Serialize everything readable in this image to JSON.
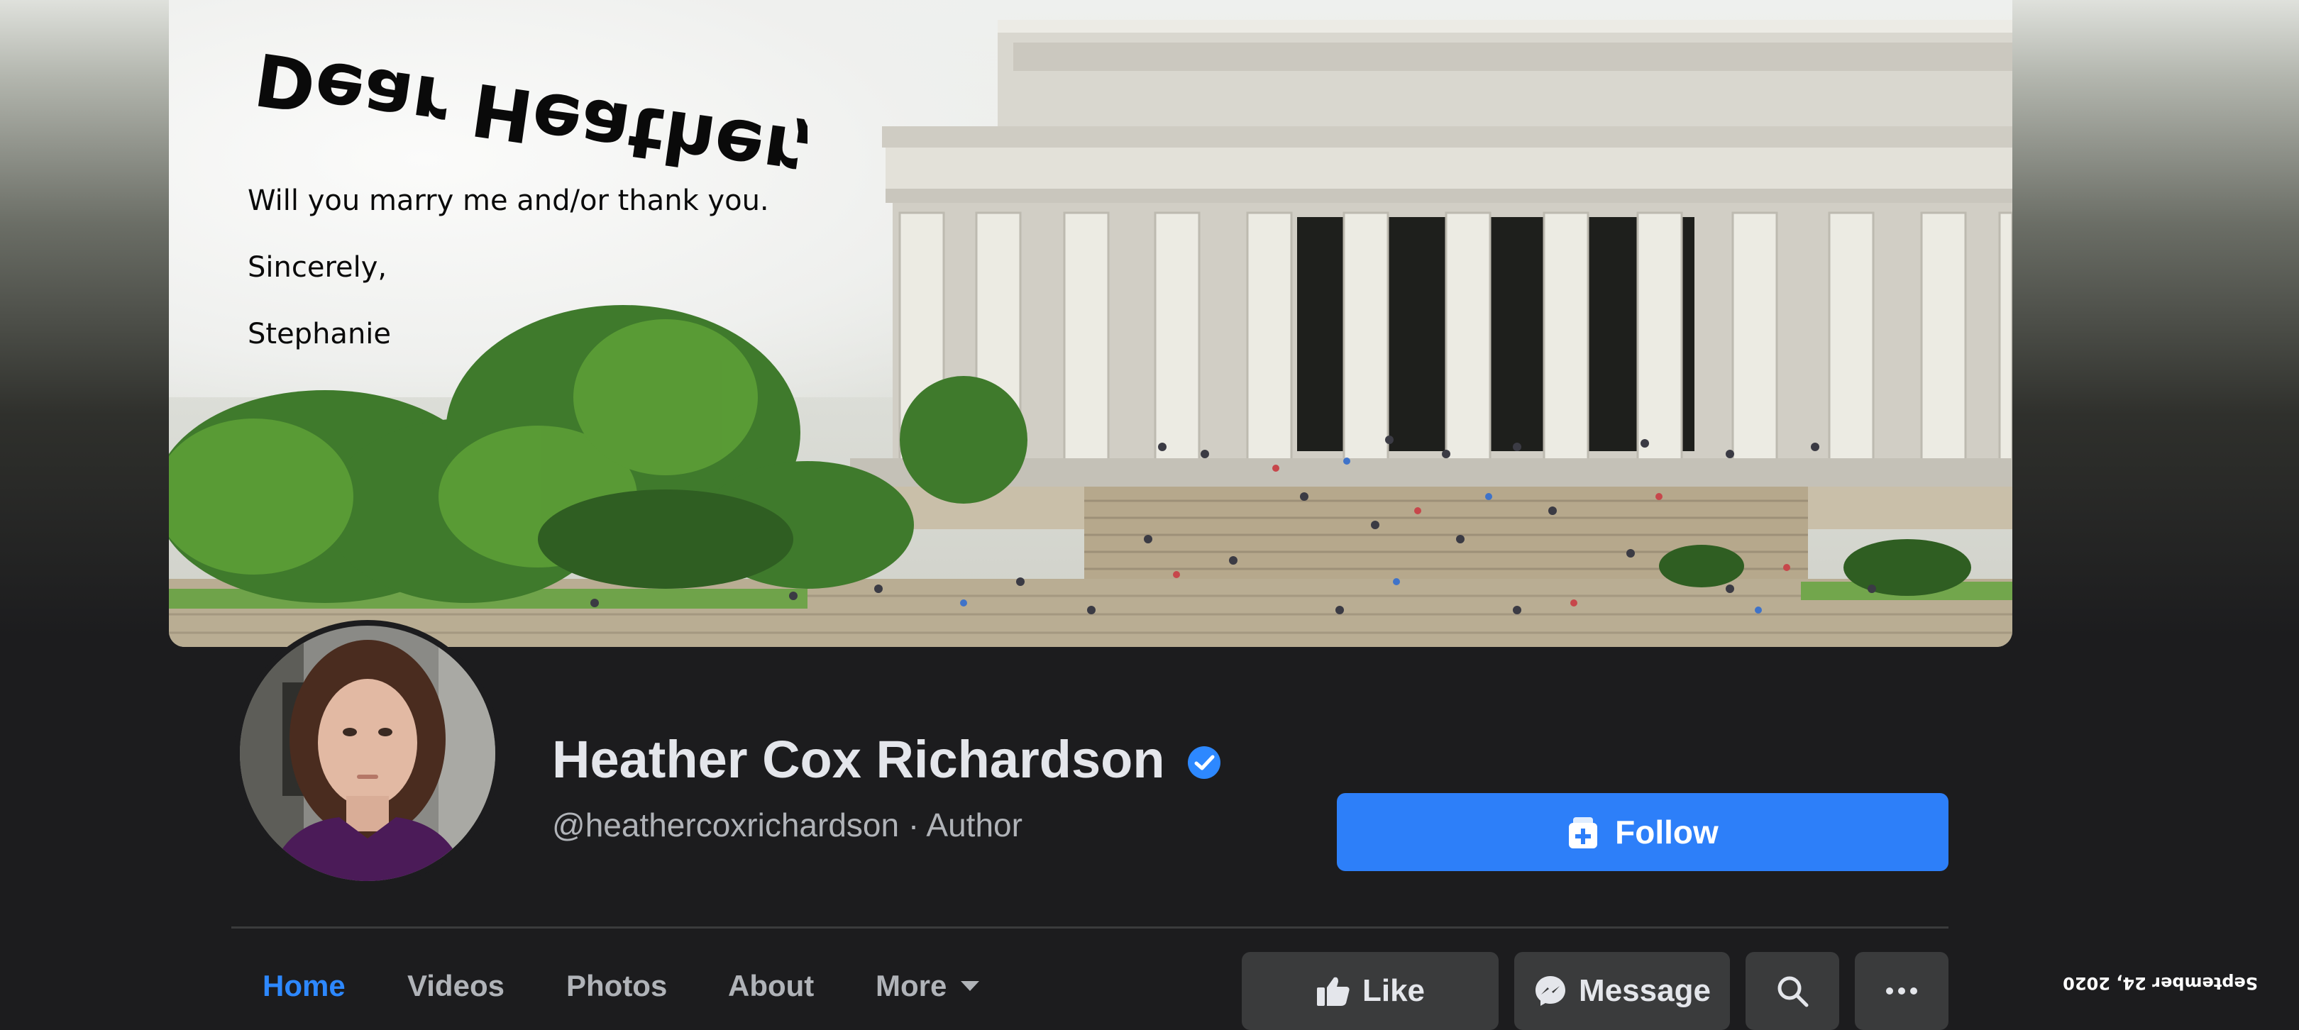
{
  "cover": {
    "letter_heading": "Dear Heather,",
    "letter_lines": [
      "Will you marry me and/or thank you.",
      "Sincerely,",
      "Stephanie"
    ]
  },
  "profile": {
    "name": "Heather Cox Richardson",
    "subtitle": "@heathercoxrichardson · Author",
    "follow_label": "Follow",
    "verified_icon": "verified-badge-icon"
  },
  "tabs": [
    {
      "label": "Home",
      "active": true
    },
    {
      "label": "Videos",
      "active": false
    },
    {
      "label": "Photos",
      "active": false
    },
    {
      "label": "About",
      "active": false
    },
    {
      "label": "More",
      "active": false
    }
  ],
  "actions": {
    "like_label": "Like",
    "message_label": "Message"
  },
  "date_stamp": "September 24, 2020",
  "colors": {
    "accent": "#2d7ff9",
    "active_tab": "#2d88ff",
    "background": "#1c1c1e",
    "button_bg": "#3a3b3c"
  }
}
